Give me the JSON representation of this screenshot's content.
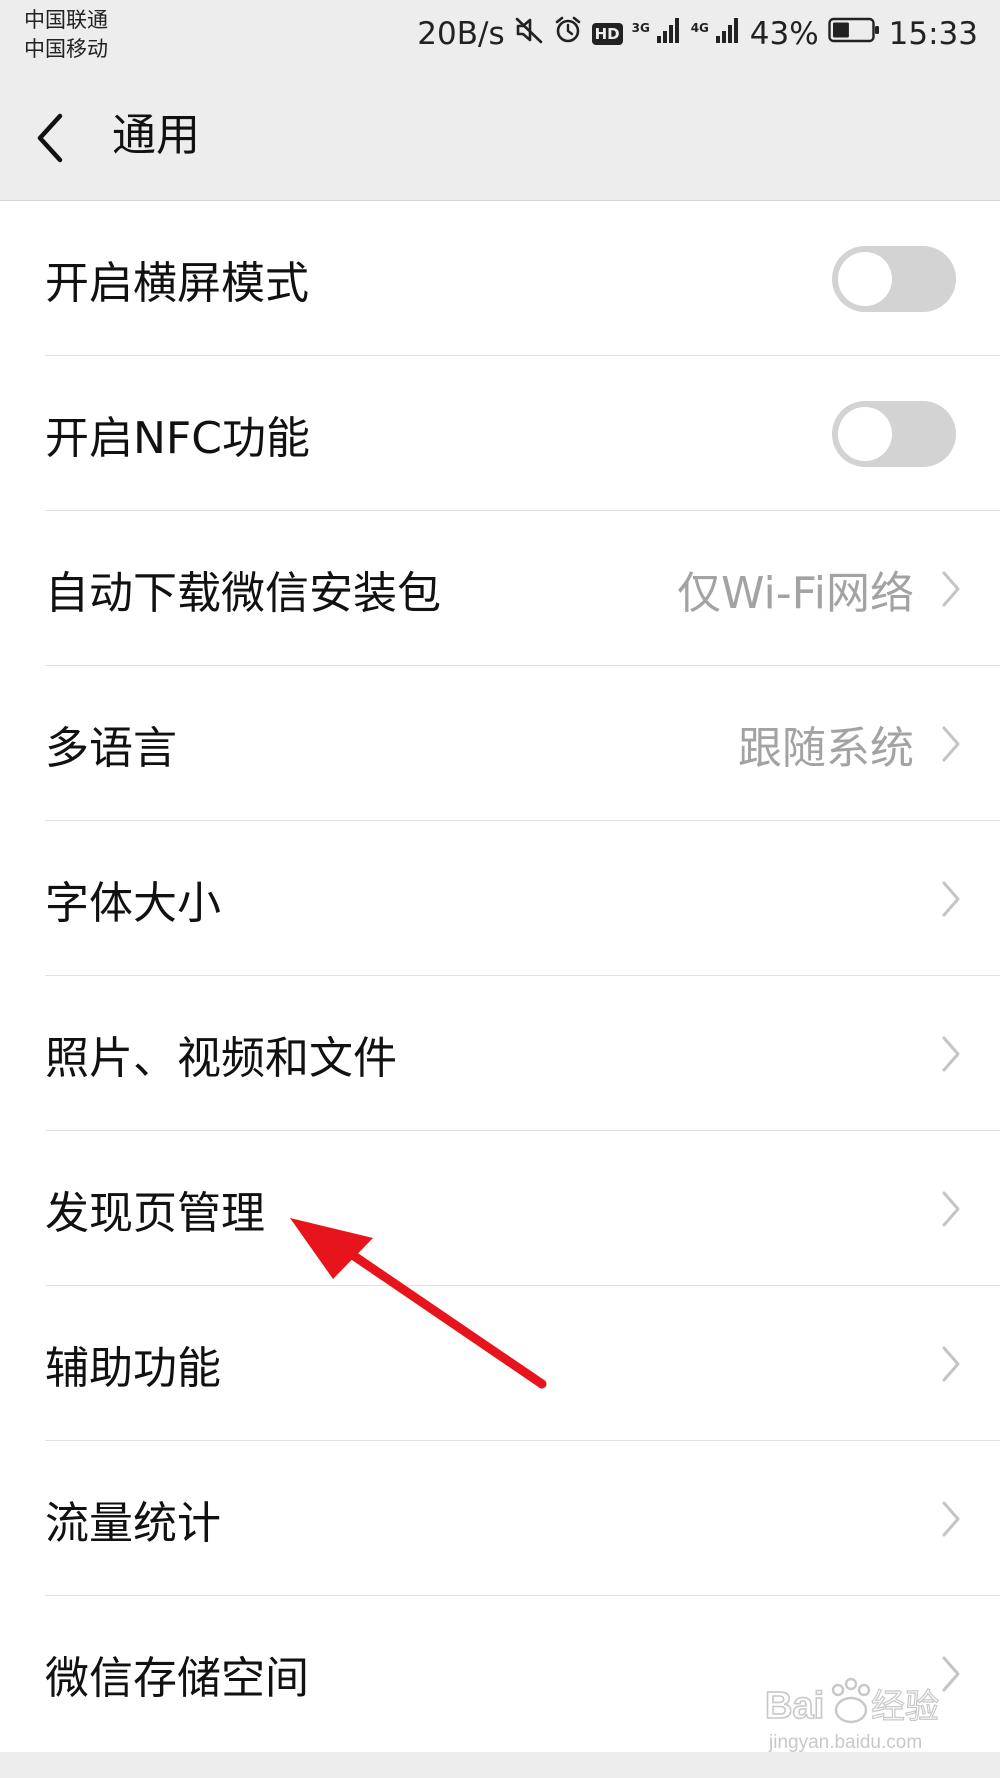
{
  "status_bar": {
    "carrier_1": "中国联通",
    "carrier_2": "中国移动",
    "net_speed": "20B/s",
    "hd_badge": "HD",
    "net_3g": "3G",
    "net_4g": "4G",
    "battery": "43%",
    "battery_level": 0.43,
    "time": "15:33",
    "icons": [
      "mute-icon",
      "alarm-icon",
      "hd-icon",
      "signal-3g-icon",
      "signal-4g-icon",
      "battery-icon"
    ]
  },
  "header": {
    "back_icon": "chevron-left-icon",
    "title": "通用"
  },
  "settings": {
    "items": [
      {
        "label": "开启横屏模式",
        "type": "toggle",
        "on": false
      },
      {
        "label": "开启NFC功能",
        "type": "toggle",
        "on": false
      },
      {
        "label": "自动下载微信安装包",
        "value": "仅Wi-Fi网络",
        "type": "link"
      },
      {
        "label": "多语言",
        "value": "跟随系统",
        "type": "link"
      },
      {
        "label": "字体大小",
        "type": "link"
      },
      {
        "label": "照片、视频和文件",
        "type": "link"
      },
      {
        "label": "发现页管理",
        "type": "link"
      },
      {
        "label": "辅助功能",
        "type": "link"
      },
      {
        "label": "流量统计",
        "type": "link"
      },
      {
        "label": "微信存储空间",
        "type": "link"
      }
    ]
  },
  "annotation": {
    "color": "#e8141b",
    "points_to": "发现页管理"
  },
  "watermark": {
    "text": "Baidu经验",
    "url_text": "jingyan.baidu.com"
  },
  "colors": {
    "bar_background": "#ededed",
    "list_background": "#ffffff",
    "divider": "#e2e2e2",
    "secondary_text": "#a3a3a3",
    "toggle_off": "#d3d3d3"
  }
}
